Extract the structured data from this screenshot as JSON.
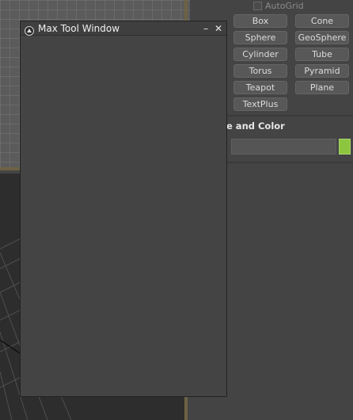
{
  "command_panel": {
    "autogrid_label": "AutoGrid",
    "object_types": [
      "Box",
      "Cone",
      "Sphere",
      "GeoSphere",
      "Cylinder",
      "Tube",
      "Torus",
      "Pyramid",
      "Teapot",
      "Plane",
      "TextPlus"
    ],
    "name_color_title": "e and Color",
    "name_value": "",
    "object_color": "#8cc63f"
  },
  "tool_window": {
    "title": "Max Tool Window",
    "minimize_label": "–",
    "close_label": "✕"
  }
}
